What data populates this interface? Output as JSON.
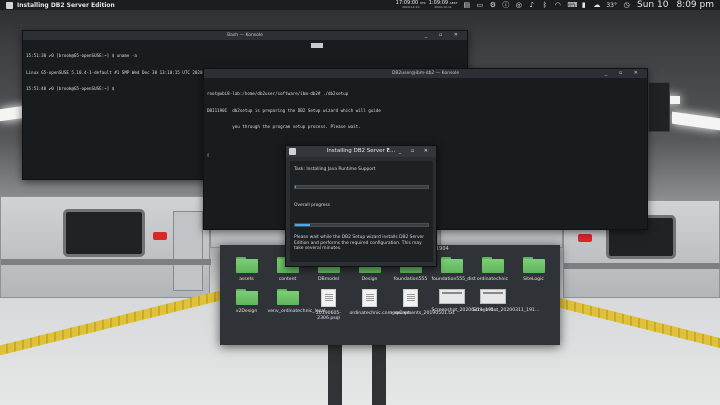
{
  "topbar": {
    "title": "Installing DB2 Server Edition",
    "clock1": {
      "time": "17:09:00",
      "tz": "UTC",
      "date": "2020-12-10"
    },
    "clock2": {
      "time": "1:09:09",
      "tz": "AEST",
      "date": "2020-12-11"
    },
    "temperature": "33°",
    "day": "Sun 10",
    "time": "8:09 pm"
  },
  "terminal1": {
    "title": "Bash — Konsole",
    "lines": [
      "15:51:38 ✔0 [brook@G5-openSUSE:~] $ uname -a",
      "Linux G5-openSUSE 5.10.4-1-default #1 SMP Wed Dec 30 13:10:15 UTC 2020 (418ccf) x86_64 x86_64 x86_64 GNU/Linux",
      "15:51:40 ✔0 [brook@G5-openSUSE:~] $ "
    ]
  },
  "terminal2": {
    "title": "DB2user@ibm-db2 — Konsole",
    "lines": [
      "root@ubi8-lab:/home/db2user/software/ibm-db2# ./db2setup",
      "DBI1190I  db2setup is preparing the DB2 Setup wizard which will guide",
      "          you through the program setup process. Please wait.",
      "",
      "▯"
    ]
  },
  "installer": {
    "title": "Installing DB2 Server E...",
    "task_label": "Task: Installing Java Runtime Support",
    "task_progress": 0.01,
    "overall_label": "Overall progress",
    "overall_progress": 0.11,
    "message": "Please wait while the DB2 Setup wizard installs DB2 Server Edition and performs the required configuration. This may take several minutes."
  },
  "file_manager": {
    "header": "1904",
    "items": [
      {
        "name": "assets",
        "kind": "folder"
      },
      {
        "name": "content",
        "kind": "folder"
      },
      {
        "name": "DBmodel",
        "kind": "folder"
      },
      {
        "name": "Design",
        "kind": "folder"
      },
      {
        "name": "foundation555",
        "kind": "folder"
      },
      {
        "name": "foundation555_dist",
        "kind": "folder"
      },
      {
        "name": "ordinatechnic",
        "kind": "folder"
      },
      {
        "name": "SiteLogic",
        "kind": "folder"
      },
      {
        "name": "v2Design",
        "kind": "folder"
      },
      {
        "name": "venv_ordinatechnic_local",
        "kind": "folder"
      },
      {
        "name": "20190605-2306.psql",
        "kind": "document"
      },
      {
        "name": "ordinatechnic.com_reCapt...",
        "kind": "document"
      },
      {
        "name": "requirements_20190501.txt",
        "kind": "document"
      },
      {
        "name": "Screenshot_20200311_191...",
        "kind": "image"
      },
      {
        "name": "Screenshot_20200311_191...",
        "kind": "image"
      }
    ]
  }
}
